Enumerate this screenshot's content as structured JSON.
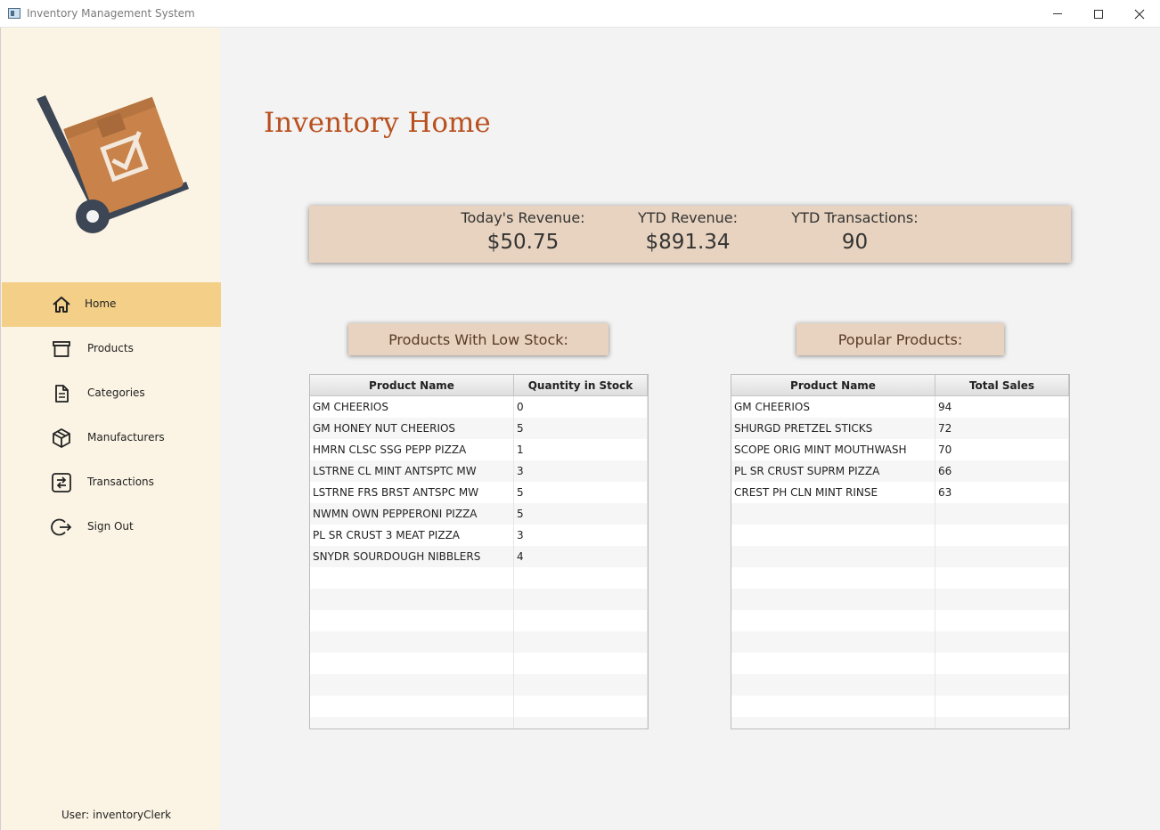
{
  "window": {
    "title": "Inventory Management System"
  },
  "page": {
    "title": "Inventory Home"
  },
  "stats": [
    {
      "label": "Today's Revenue:",
      "value": "$50.75"
    },
    {
      "label": "YTD Revenue:",
      "value": "$891.34"
    },
    {
      "label": "YTD Transactions:",
      "value": "90"
    }
  ],
  "sidebar": {
    "items": [
      {
        "label": "Home",
        "icon": "home-icon"
      },
      {
        "label": "Products",
        "icon": "archive-box-icon"
      },
      {
        "label": "Categories",
        "icon": "document-icon"
      },
      {
        "label": "Manufacturers",
        "icon": "cube-icon"
      },
      {
        "label": "Transactions",
        "icon": "swap-arrows-icon"
      },
      {
        "label": "Sign Out",
        "icon": "sign-out-icon"
      }
    ],
    "user": "User: inventoryClerk"
  },
  "low_stock": {
    "title": "Products With Low Stock:",
    "columns": [
      "Product Name",
      "Quantity in Stock"
    ],
    "rows": [
      [
        "GM CHEERIOS",
        "0"
      ],
      [
        "GM HONEY NUT CHEERIOS",
        "5"
      ],
      [
        "HMRN CLSC SSG PEPP PIZZA",
        "1"
      ],
      [
        "LSTRNE CL MINT ANTSPTC MW",
        "3"
      ],
      [
        "LSTRNE FRS BRST ANTSPC MW",
        "5"
      ],
      [
        "NWMN OWN PEPPERONI PIZZA",
        "5"
      ],
      [
        "PL SR CRUST 3 MEAT PIZZA",
        "3"
      ],
      [
        "SNYDR SOURDOUGH NIBBLERS",
        "4"
      ]
    ]
  },
  "popular": {
    "title": "Popular Products:",
    "columns": [
      "Product Name",
      "Total Sales"
    ],
    "rows": [
      [
        "GM CHEERIOS",
        "94"
      ],
      [
        "SHURGD PRETZEL STICKS",
        "72"
      ],
      [
        "SCOPE ORIG MINT MOUTHWASH",
        "70"
      ],
      [
        "PL SR CRUST SUPRM PIZZA",
        "66"
      ],
      [
        "CREST PH CLN MINT RINSE",
        "63"
      ]
    ]
  },
  "colors": {
    "accent": "#b8501e",
    "sidebar_bg": "#fbf4e4",
    "sidebar_active": "#f3cf88",
    "card_bg": "#e7d3bf"
  }
}
